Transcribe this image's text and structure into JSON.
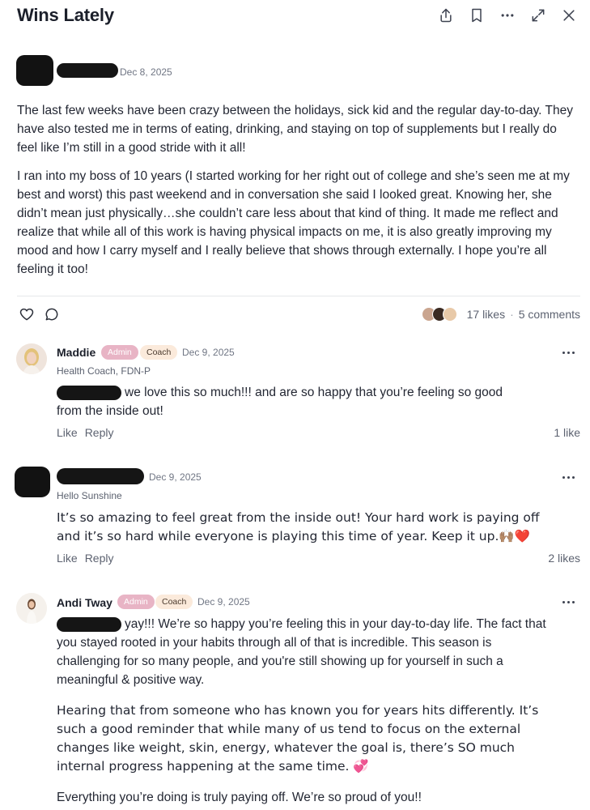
{
  "header": {
    "title": "Wins Lately",
    "icons": [
      "share-icon",
      "bookmark-icon",
      "more-icon",
      "expand-icon",
      "close-icon"
    ]
  },
  "post": {
    "date": "Dec 8, 2025",
    "paragraphs": [
      "The last few weeks have been crazy between the holidays, sick kid and the regular day-to-day. They have also tested me in terms of eating, drinking, and staying on top of supplements but I really do feel like I’m still in a good stride with it all!",
      "I ran into my boss of 10 years (I started working for her right out of college and she’s seen me at my best and worst) this past weekend and in conversation she said I looked great. Knowing her, she didn’t mean just physically…she couldn’t care less about that kind of thing. It made me reflect and realize that while all of this work is having physical impacts on me, it is also greatly improving my mood and how I carry myself and I really believe that shows through externally. I hope you’re all feeling it too!"
    ],
    "likes": "17 likes",
    "separator": "·",
    "comments": "5 comments"
  },
  "comments": [
    {
      "name": "Maddie",
      "badges": [
        "Admin",
        "Coach"
      ],
      "date": "Dec 9, 2025",
      "subtitle": "Health Coach, FDN-P",
      "text": "we love this so much!!! and are so happy that you’re feeling so good from the inside out!",
      "like_label": "Like",
      "reply_label": "Reply",
      "likes": "1 like"
    },
    {
      "date": "Dec 9, 2025",
      "subtitle": "Hello Sunshine",
      "text": "It’s so amazing to feel great from the inside out! Your hard work is paying off and it’s so hard while everyone is playing this time of year. Keep it up.🙌🏽❤️",
      "like_label": "Like",
      "reply_label": "Reply",
      "likes": "2 likes"
    },
    {
      "name": "Andi Tway",
      "badges": [
        "Admin",
        "Coach"
      ],
      "date": "Dec 9, 2025",
      "paragraphs": [
        "yay!!! We’re so happy you’re feeling this in your day-to-day life. The fact that you stayed rooted in your habits through all of that is incredible. This season is challenging for so many people, and you're still showing up for yourself in such a meaningful & positive way.",
        "Hearing that from someone who has known you for years hits differently. It’s such a good reminder that while many of us tend to focus on the external changes like weight, skin, energy, whatever the goal is, there’s SO much internal progress happening at the same time. 💞",
        "Everything you’re doing is truly paying off. We’re so proud of you!!"
      ]
    }
  ]
}
